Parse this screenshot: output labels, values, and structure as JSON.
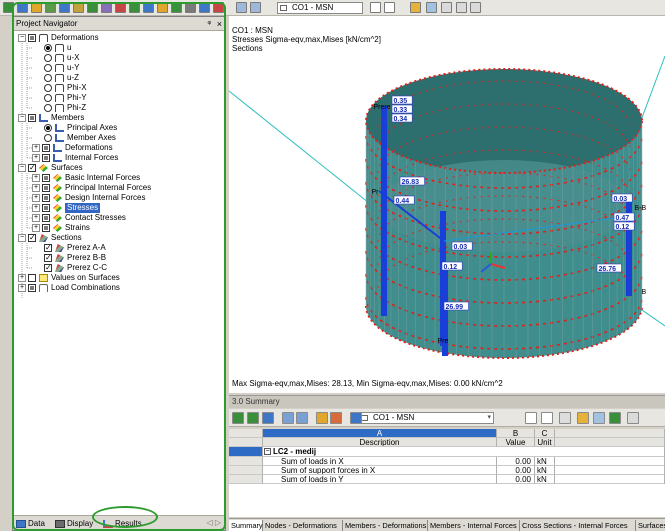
{
  "toolbar": {
    "loadcase_combo": "CO1 - MSN",
    "icon_colors": [
      "#3a8f3a",
      "#3f77c8",
      "#e0a72c",
      "#5a9b4a",
      "#3f77c8",
      "#c3a23a",
      "#3a8f3a",
      "#8a6fb8",
      "#c84545",
      "#3a8f3a",
      "#3f77c8",
      "#e0a72c",
      "#3a8f3a",
      "#7a7a7a",
      "#3f77c8",
      "#c84545"
    ],
    "right_icons": [
      "table-icon",
      "table-icon",
      "arrow-left-icon",
      "arrow-right-icon",
      "axis-icon",
      "grid-icon",
      "filter-icon",
      "table-icon",
      "table-icon"
    ]
  },
  "navigator": {
    "title": "Project Navigator",
    "pin": "ᵠ",
    "close": "×",
    "items": [
      {
        "label": "Deformations",
        "level": 0,
        "expander": "−",
        "control": "partial",
        "icon": "def"
      },
      {
        "label": "u",
        "level": 1,
        "control": "radio-on",
        "icon": "def"
      },
      {
        "label": "u-X",
        "level": 1,
        "control": "radio",
        "icon": "def"
      },
      {
        "label": "u-Y",
        "level": 1,
        "control": "radio",
        "icon": "def"
      },
      {
        "label": "u-Z",
        "level": 1,
        "control": "radio",
        "icon": "def"
      },
      {
        "label": "Phi-X",
        "level": 1,
        "control": "radio",
        "icon": "def"
      },
      {
        "label": "Phi-Y",
        "level": 1,
        "control": "radio",
        "icon": "def"
      },
      {
        "label": "Phi-Z",
        "level": 1,
        "control": "radio",
        "icon": "def"
      },
      {
        "label": "Members",
        "level": 0,
        "expander": "−",
        "control": "partial",
        "icon": "mem"
      },
      {
        "label": "Principal Axes",
        "level": 1,
        "control": "radio-on",
        "icon": "mem"
      },
      {
        "label": "Member Axes",
        "level": 1,
        "control": "radio",
        "icon": "mem"
      },
      {
        "label": "Deformations",
        "level": 1,
        "expander": "+",
        "control": "partial",
        "icon": "mem"
      },
      {
        "label": "Internal Forces",
        "level": 1,
        "expander": "+",
        "control": "partial",
        "icon": "mem"
      },
      {
        "label": "Surfaces",
        "level": 0,
        "expander": "−",
        "control": "checked",
        "icon": "surf"
      },
      {
        "label": "Basic Internal Forces",
        "level": 1,
        "expander": "+",
        "control": "partial",
        "icon": "surf"
      },
      {
        "label": "Principal Internal Forces",
        "level": 1,
        "expander": "+",
        "control": "partial",
        "icon": "surf"
      },
      {
        "label": "Design Internal Forces",
        "level": 1,
        "expander": "+",
        "control": "partial",
        "icon": "surf"
      },
      {
        "label": "Stresses",
        "level": 1,
        "expander": "+",
        "control": "partial",
        "icon": "surf",
        "selected": true
      },
      {
        "label": "Contact Stresses",
        "level": 1,
        "expander": "+",
        "control": "partial",
        "icon": "surf"
      },
      {
        "label": "Strains",
        "level": 1,
        "expander": "+",
        "control": "partial",
        "icon": "surf"
      },
      {
        "label": "Sections",
        "level": 0,
        "expander": "−",
        "control": "checked",
        "icon": "sec"
      },
      {
        "label": "Prerez A-A",
        "level": 1,
        "control": "checked",
        "icon": "sec"
      },
      {
        "label": "Prerez B-B",
        "level": 1,
        "control": "checked",
        "icon": "sec"
      },
      {
        "label": "Prerez C-C",
        "level": 1,
        "control": "checked",
        "icon": "sec"
      },
      {
        "label": "Values on Surfaces",
        "level": 0,
        "expander": "+",
        "control": "empty",
        "icon": "val"
      },
      {
        "label": "Load Combinations",
        "level": 0,
        "expander": "+",
        "control": "partial",
        "icon": "lc"
      }
    ],
    "tabs": [
      {
        "label": "Data",
        "icon": "data-icon"
      },
      {
        "label": "Display",
        "icon": "display-icon"
      },
      {
        "label": "Results",
        "icon": "results-icon"
      }
    ],
    "tab_arrows": "◁ ▷"
  },
  "view": {
    "line1": "CO1 : MSN",
    "line2": "Stresses Sigma-eqv,max,Mises [kN/cm^2]",
    "line3": "Sections",
    "footer": "Max Sigma-eqv,max,Mises: 28.13, Min Sigma-eqv,max,Mises: 0.00 kN/cm^2",
    "value_labels": [
      {
        "text": "Prere",
        "style": "plain"
      },
      {
        "text": "0.35",
        "style": "box"
      },
      {
        "text": "0.33",
        "style": "box"
      },
      {
        "text": "0.34",
        "style": "box"
      },
      {
        "text": "26.83",
        "style": "box"
      },
      {
        "text": "0.44",
        "style": "box"
      },
      {
        "text": "Pr",
        "style": "plain"
      },
      {
        "text": "0.03",
        "style": "box"
      },
      {
        "text": "0.47",
        "style": "box"
      },
      {
        "text": "0.12",
        "style": "box"
      },
      {
        "text": "B-B",
        "style": "plain"
      },
      {
        "text": "0.03",
        "style": "box"
      },
      {
        "text": "0.12",
        "style": "box"
      },
      {
        "text": "26.76",
        "style": "box"
      },
      {
        "text": "B",
        "style": "plain"
      },
      {
        "text": "26.99",
        "style": "box"
      },
      {
        "text": "Pre",
        "style": "plain"
      }
    ],
    "colors": {
      "shell": "#3f8d8c",
      "shell_dark": "#2d6e6e",
      "support": "#e0201a",
      "bar": "#1a3fd9",
      "hatch": "#7fa6a5"
    }
  },
  "summary": {
    "title": "3.0 Summary",
    "combo": "CO1 - MSN",
    "combo_color": "#ffffff",
    "icons": [
      "export-icon",
      "import-icon",
      "table-icon",
      "copy-icon",
      "paste-icon",
      "filter-icon",
      "color-icon",
      "table-icon",
      "print-icon"
    ],
    "columns": [
      {
        "letter": "A",
        "name": "Description"
      },
      {
        "letter": "B",
        "name": "Value"
      },
      {
        "letter": "C",
        "name": "Unit"
      }
    ],
    "group": "LC2 - medij",
    "group_toggle": "−",
    "rows": [
      {
        "description": "Sum of loads in X",
        "value": "0.00",
        "unit": "kN"
      },
      {
        "description": "Sum of support forces in X",
        "value": "0.00",
        "unit": "kN"
      },
      {
        "description": "Sum of loads in Y",
        "value": "0.00",
        "unit": "kN"
      }
    ],
    "tabs": [
      "Summary",
      "Nodes - Deformations",
      "Members - Deformations",
      "Members - Internal Forces",
      "Cross Sections - Internal Forces",
      "Surfaces"
    ]
  }
}
